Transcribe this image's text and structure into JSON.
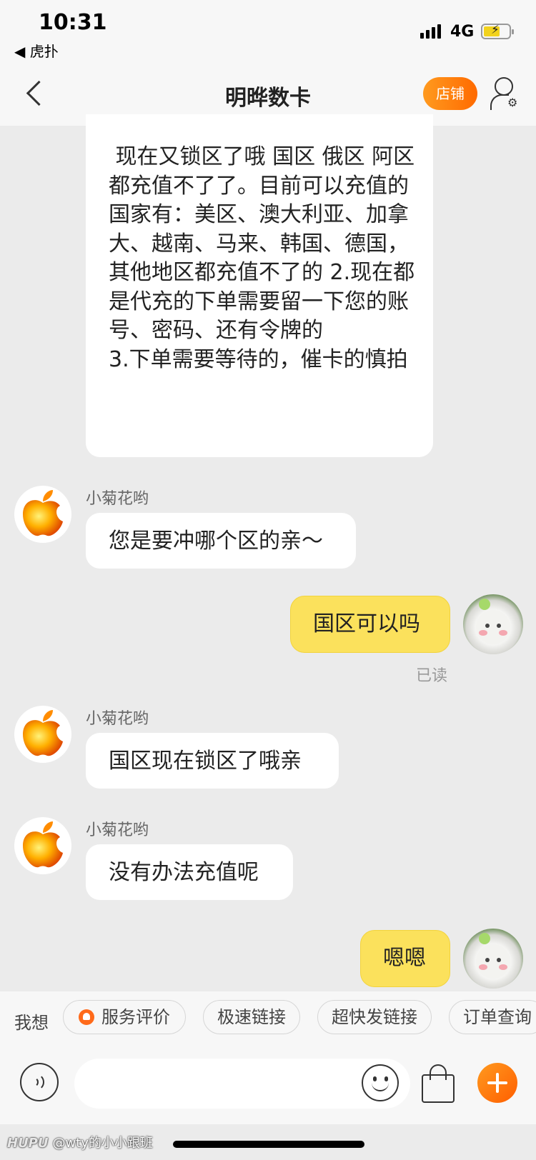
{
  "status_bar": {
    "time": "10:31",
    "back_app": "◀ 虎扑",
    "network": "4G"
  },
  "nav": {
    "title": "明晔数卡",
    "shop_button": "店铺"
  },
  "messages": {
    "top_long": {
      "text": " 现在又锁区了哦 国区 俄区 阿区都充值不了了。目前可以充值的国家有：美区、澳大利亚、加拿大、越南、马来、韩国、德国，其他地区都充值不了的 2.现在都是代充的下单需要留一下您的账号、密码、还有令牌的\n3.下单需要等待的，催卡的慎拍"
    },
    "m1": {
      "sender": "小菊花哟",
      "text": "您是要冲哪个区的亲～"
    },
    "m2": {
      "text": "国区可以吗",
      "status": "已读"
    },
    "m3": {
      "sender": "小菊花哟",
      "text": "国区现在锁区了哦亲"
    },
    "m4": {
      "sender": "小菊花哟",
      "text": "没有办法充值呢"
    },
    "m5": {
      "text": "嗯嗯"
    }
  },
  "quick_bar": {
    "prefix": "我想",
    "chips": [
      "服务评价",
      "极速链接",
      "超快发链接",
      "订单查询"
    ]
  },
  "input_bar": {
    "placeholder": ""
  },
  "watermark": {
    "brand": "HUPU",
    "handle": "@wty的小小跟班"
  },
  "colors": {
    "accent": "#ff7a00",
    "sent_bubble": "#fbe15c",
    "background": "#ebebeb"
  }
}
